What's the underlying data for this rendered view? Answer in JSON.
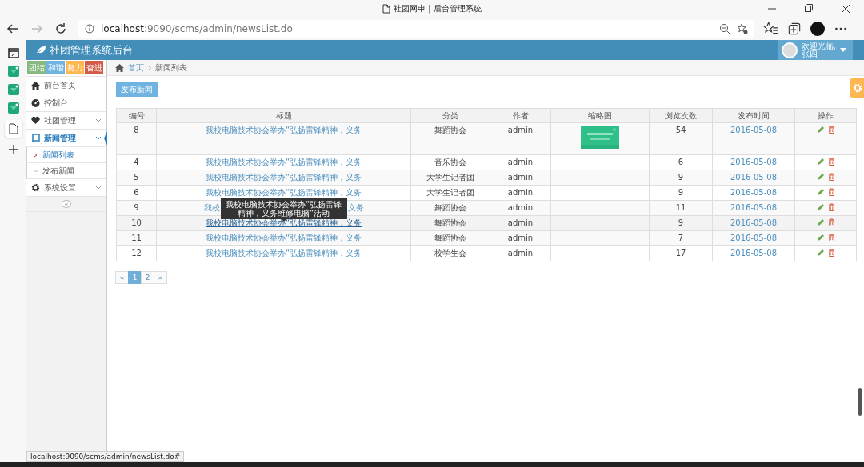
{
  "browser": {
    "tab_title": "社团网申 | 后台管理系统",
    "url_host": "localhost",
    "url_path": ":9090/scms/admin/newsList.do",
    "status_url": "localhost:9090/scms/admin/newsList.do#"
  },
  "app": {
    "title": "社团管理系统后台",
    "user": {
      "greeting": "欢迎光临,",
      "name": "张四"
    }
  },
  "badges": [
    {
      "label": "团结",
      "color": "#87b87f"
    },
    {
      "label": "和谐",
      "color": "#6fb3e0"
    },
    {
      "label": "努力",
      "color": "#ffb752"
    },
    {
      "label": "奋进",
      "color": "#d15b47"
    }
  ],
  "menu": [
    {
      "kind": "link",
      "label": "前台首页",
      "selected": false
    },
    {
      "kind": "link",
      "label": "控制台",
      "selected": false
    },
    {
      "kind": "group",
      "label": "社团管理",
      "expanded": false,
      "selected": false
    },
    {
      "kind": "group",
      "label": "新闻管理",
      "expanded": true,
      "selected": true,
      "children": [
        {
          "label": "新闻列表",
          "selected": true
        },
        {
          "label": "发布新闻",
          "selected": false
        }
      ]
    },
    {
      "kind": "group",
      "label": "系统设置",
      "expanded": false,
      "selected": false
    }
  ],
  "collapse_button": "«",
  "breadcrumb": [
    "首页",
    "新闻列表"
  ],
  "publish_button": "发布新闻",
  "table": {
    "columns": [
      "编号",
      "标题",
      "分类",
      "作者",
      "缩略图",
      "浏览次数",
      "发布时间",
      "操作"
    ],
    "rows": [
      {
        "id": "8",
        "title": "我校电脑技术协会举办“弘扬雷锋精神，义务",
        "category": "舞蹈协会",
        "author": "admin",
        "views": "54",
        "date": "2016-05-08",
        "hovered": false
      },
      {
        "id": "4",
        "title": "我校电脑技术协会举办“弘扬雷锋精神，义务",
        "category": "音乐协会",
        "author": "admin",
        "views": "6",
        "date": "2016-05-08",
        "hovered": false
      },
      {
        "id": "5",
        "title": "我校电脑技术协会举办“弘扬雷锋精神，义务",
        "category": "大学生记者团",
        "author": "admin",
        "views": "9",
        "date": "2016-05-08",
        "hovered": false
      },
      {
        "id": "6",
        "title": "我校电脑技术协会举办“弘扬雷锋精神，义务",
        "category": "大学生记者团",
        "author": "admin",
        "views": "9",
        "date": "2016-05-08",
        "hovered": false
      },
      {
        "id": "9",
        "title_parts": [
          "我校",
          "义务"
        ],
        "category": "舞蹈协会",
        "author": "admin",
        "views": "11",
        "date": "2016-05-08",
        "hovered": false
      },
      {
        "id": "10",
        "title": "我校电脑技术协会举办“弘扬雷锋精神，义务",
        "category": "舞蹈协会",
        "author": "admin",
        "views": "9",
        "date": "2016-05-08",
        "hovered": true,
        "tooltip": "我校电脑技术协会举办“弘扬雷锋精神，义务维修电脑”活动"
      },
      {
        "id": "11",
        "title": "我校电脑技术协会举办“弘扬雷锋精神，义务",
        "category": "舞蹈协会",
        "author": "admin",
        "views": "7",
        "date": "2016-05-08",
        "hovered": false
      },
      {
        "id": "12",
        "title": "我校电脑技术协会举办“弘扬雷锋精神，义务",
        "category": "校学生会",
        "author": "admin",
        "views": "17",
        "date": "2016-05-08",
        "hovered": false
      }
    ]
  },
  "pagination": [
    {
      "label": "«",
      "selected": false
    },
    {
      "label": "1",
      "selected": true
    },
    {
      "label": "2",
      "selected": false
    },
    {
      "label": "»",
      "selected": false
    }
  ]
}
